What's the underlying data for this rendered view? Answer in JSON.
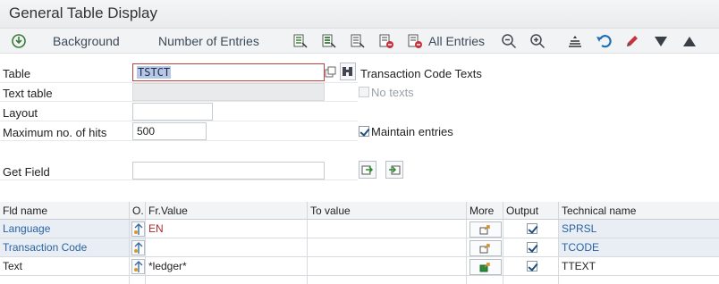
{
  "window": {
    "title": "General Table Display"
  },
  "toolbar": {
    "background_label": "Background",
    "num_entries_label": "Number of Entries",
    "all_entries_label": "All Entries"
  },
  "form": {
    "table_label": "Table",
    "table_value": "TSTCT",
    "table_description": "Transaction Code Texts",
    "text_table_label": "Text table",
    "no_texts_label": "No texts",
    "layout_label": "Layout",
    "max_hits_label": "Maximum no. of hits",
    "max_hits_value": "500",
    "maintain_entries_label": "Maintain entries",
    "get_field_label": "Get Field"
  },
  "grid": {
    "headers": [
      "Fld name",
      "O.",
      "Fr.Value",
      "To value",
      "More",
      "Output",
      "Technical name"
    ],
    "rows": [
      {
        "fld_name": "Language",
        "from_value": "EN",
        "to_value": "",
        "output": true,
        "technical_name": "SPRSL"
      },
      {
        "fld_name": "Transaction Code",
        "from_value": "",
        "to_value": "",
        "output": true,
        "technical_name": "TCODE"
      },
      {
        "fld_name": "Text",
        "from_value": "*ledger*",
        "to_value": "",
        "output": true,
        "technical_name": "TTEXT"
      }
    ]
  },
  "colors": {
    "accent_blue": "#2a63a2",
    "value_red": "#b0292e",
    "focus_red": "#c04040"
  }
}
